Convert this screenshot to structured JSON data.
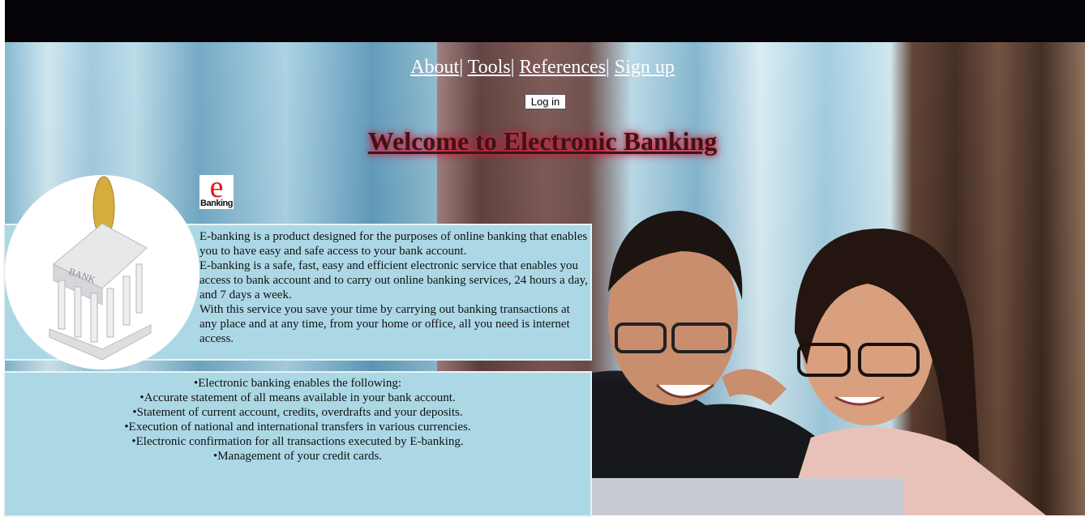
{
  "nav": {
    "items": [
      "About",
      "Tools",
      "References",
      "Sign up"
    ],
    "separator": "|"
  },
  "login_label": "Log in",
  "title": "Welcome to Electronic Banking",
  "logo": {
    "letter": "e",
    "text": "Banking"
  },
  "intro": [
    "E-banking is a product designed for the purposes of online banking that enables you to have easy and safe access to your bank account.",
    "E-banking is a safe, fast, easy and efficient electronic service that enables you access to bank account and to carry out online banking services, 24 hours a day, and 7 days a week.",
    "With this service you save your time by carrying out banking transactions at any place and at any time, from your home or office, all you need is internet access."
  ],
  "features": [
    "•Electronic banking enables the following:",
    "•Accurate statement of all means available in your bank account.",
    "•Statement of current account, credits, overdrafts and your deposits.",
    "•Execution of national and international transfers in various currencies.",
    "•Electronic confirmation for all transactions executed by E-banking.",
    "•Management of your credit cards."
  ],
  "bank_sign": "BANK"
}
